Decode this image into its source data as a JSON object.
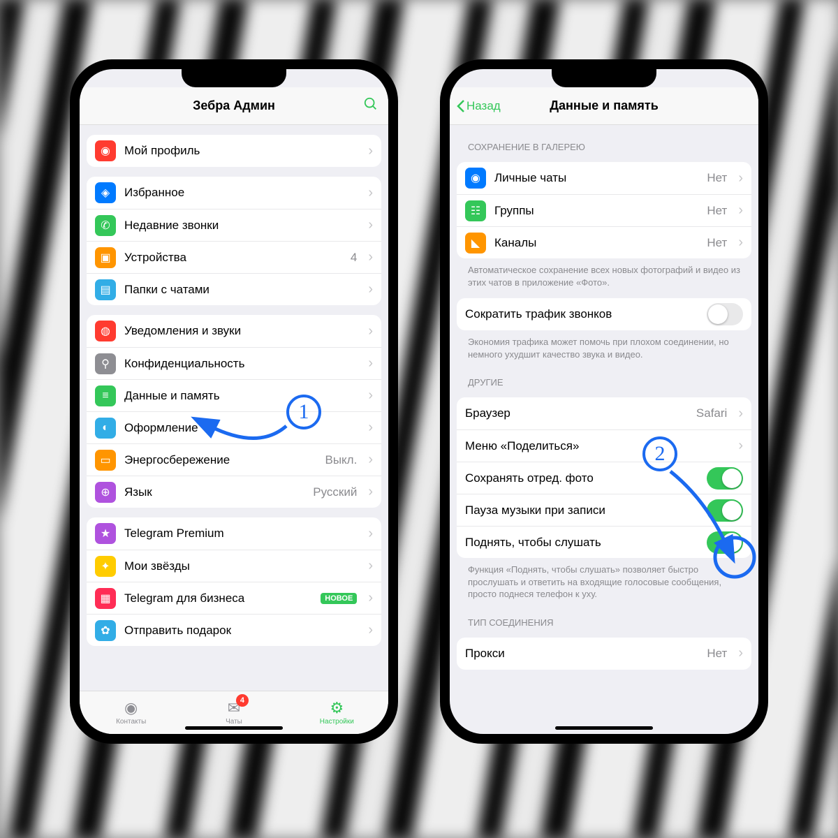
{
  "left": {
    "title": "Зебра Админ",
    "groups": [
      {
        "rows": [
          {
            "icon": "person-icon",
            "bg": "c-red",
            "label": "Мой профиль",
            "chev": true
          }
        ]
      },
      {
        "rows": [
          {
            "icon": "bookmark-icon",
            "bg": "c-blue",
            "label": "Избранное",
            "chev": true
          },
          {
            "icon": "phone-icon",
            "bg": "c-green",
            "label": "Недавние звонки",
            "chev": true
          },
          {
            "icon": "devices-icon",
            "bg": "c-orange",
            "label": "Устройства",
            "value": "4",
            "chev": true
          },
          {
            "icon": "folder-icon",
            "bg": "c-cyan",
            "label": "Папки с чатами",
            "chev": true
          }
        ]
      },
      {
        "rows": [
          {
            "icon": "bell-icon",
            "bg": "c-red",
            "label": "Уведомления и звуки",
            "chev": true
          },
          {
            "icon": "lock-icon",
            "bg": "c-gray",
            "label": "Конфиденциальность",
            "chev": true
          },
          {
            "icon": "data-icon",
            "bg": "c-green",
            "label": "Данные и память",
            "chev": true
          },
          {
            "icon": "theme-icon",
            "bg": "c-cyan",
            "label": "Оформление",
            "chev": true
          },
          {
            "icon": "battery-icon",
            "bg": "c-orange",
            "label": "Энергосбережение",
            "value": "Выкл.",
            "chev": true
          },
          {
            "icon": "globe-icon",
            "bg": "c-purple",
            "label": "Язык",
            "value": "Русский",
            "chev": true
          }
        ]
      },
      {
        "rows": [
          {
            "icon": "star-icon",
            "bg": "c-purple",
            "label": "Telegram Premium",
            "chev": true
          },
          {
            "icon": "stars-icon",
            "bg": "c-yellow",
            "label": "Мои звёзды",
            "chev": true
          },
          {
            "icon": "business-icon",
            "bg": "c-pink",
            "label": "Telegram для бизнеса",
            "badge": "НОВОЕ",
            "chev": true
          },
          {
            "icon": "gift-icon",
            "bg": "c-cyan",
            "label": "Отправить подарок",
            "chev": true
          }
        ]
      }
    ],
    "tabs": [
      {
        "label": "Контакты",
        "icon": "contacts-icon"
      },
      {
        "label": "Чаты",
        "icon": "chats-icon",
        "badge": "4"
      },
      {
        "label": "Настройки",
        "icon": "settings-icon",
        "active": true
      }
    ]
  },
  "right": {
    "back": "Назад",
    "title": "Данные и память",
    "sections": [
      {
        "title": "СОХРАНЕНИЕ В ГАЛЕРЕЮ",
        "rows": [
          {
            "icon": "person-icon",
            "bg": "c-blue",
            "label": "Личные чаты",
            "value": "Нет",
            "chev": true
          },
          {
            "icon": "group-icon",
            "bg": "c-green",
            "label": "Группы",
            "value": "Нет",
            "chev": true
          },
          {
            "icon": "megaphone-icon",
            "bg": "c-orange",
            "label": "Каналы",
            "value": "Нет",
            "chev": true
          }
        ],
        "footer": "Автоматическое сохранение всех новых фотографий и видео из этих чатов в приложение «Фото»."
      },
      {
        "rows": [
          {
            "label": "Сократить трафик звонков",
            "toggle": "off"
          }
        ],
        "footer": "Экономия трафика может помочь при плохом соединении, но немного ухудшит качество звука и видео."
      },
      {
        "title": "ДРУГИЕ",
        "rows": [
          {
            "label": "Браузер",
            "value": "Safari",
            "chev": true
          },
          {
            "label": "Меню «Поделиться»",
            "chev": true
          },
          {
            "label": "Сохранять отред. фото",
            "toggle": "on"
          },
          {
            "label": "Пауза музыки при записи",
            "toggle": "on"
          },
          {
            "label": "Поднять, чтобы слушать",
            "toggle": "on"
          }
        ],
        "footer": "Функция «Поднять, чтобы слушать» позволяет быстро прослушать и ответить на входящие голосовые сообщения, просто поднеся телефон к уху."
      },
      {
        "title": "ТИП СОЕДИНЕНИЯ",
        "rows": [
          {
            "label": "Прокси",
            "value": "Нет",
            "chev": true
          }
        ]
      }
    ]
  },
  "annotations": {
    "step1": "1",
    "step2": "2"
  }
}
